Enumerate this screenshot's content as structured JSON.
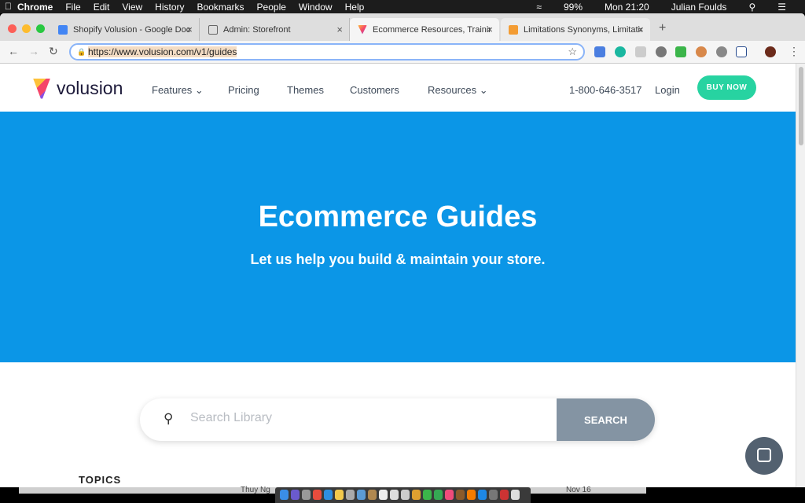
{
  "menubar": {
    "app": "Chrome",
    "items": [
      "File",
      "Edit",
      "View",
      "History",
      "Bookmarks",
      "People",
      "Window",
      "Help"
    ],
    "battery": "99%",
    "clock": "Mon 21:20",
    "user": "Julian Foulds"
  },
  "tabs": [
    {
      "title": "Shopify Volusion - Google Doc",
      "icon_color": "#4285f4"
    },
    {
      "title": "Admin: Storefront",
      "icon_color": "#ffffff"
    },
    {
      "title": "Ecommerce Resources, Training",
      "icon_color": "#f5456a"
    },
    {
      "title": "Limitations Synonyms, Limitatio",
      "icon_color": "#f39c33"
    }
  ],
  "address": {
    "url": "https://www.volusion.com/v1/guides"
  },
  "site": {
    "brand": "volusion",
    "nav": [
      "Features",
      "Pricing",
      "Themes",
      "Customers",
      "Resources"
    ],
    "phone": "1-800-646-3517",
    "login": "Login",
    "buy_now": "BUY NOW",
    "hero_title": "Ecommerce Guides",
    "hero_subtitle": "Let us help you build & maintain your store.",
    "search_placeholder": "Search Library",
    "search_button": "SEARCH",
    "topics": "TOPICS"
  },
  "background_window": {
    "sender": "Thuy Ng",
    "date": "Nov 16"
  },
  "colors": {
    "hero": "#0b96e7",
    "buy": "#27d3a1",
    "search_button": "#8494a3"
  }
}
